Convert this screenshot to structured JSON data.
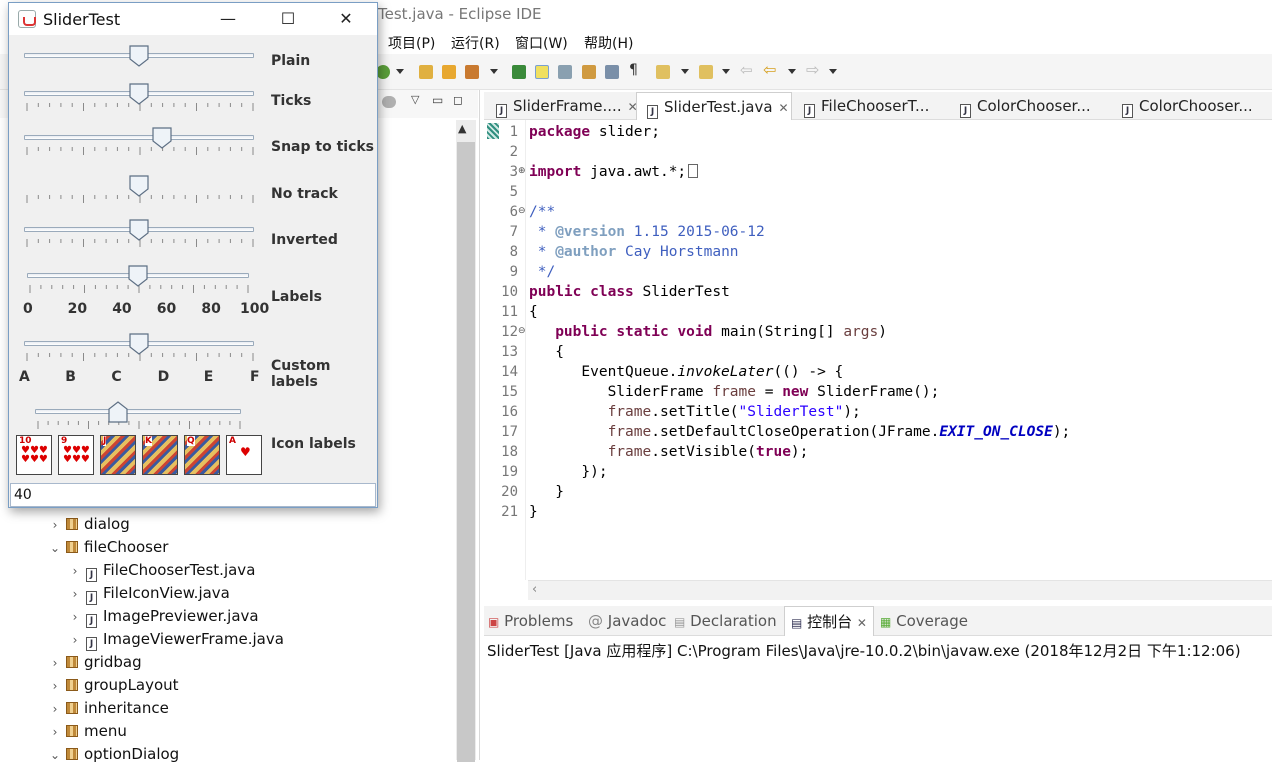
{
  "eclipse": {
    "title": "Test.java - Eclipse IDE",
    "menus": [
      "项目(P)",
      "运行(R)",
      "窗口(W)",
      "帮助(H)"
    ]
  },
  "tree": {
    "rows": [
      {
        "label": "dialog",
        "expanded": false,
        "type": "package"
      },
      {
        "label": "fileChooser",
        "expanded": true,
        "type": "package"
      },
      {
        "label": "FileChooserTest.java",
        "type": "java"
      },
      {
        "label": "FileIconView.java",
        "type": "java"
      },
      {
        "label": "ImagePreviewer.java",
        "type": "java"
      },
      {
        "label": "ImageViewerFrame.java",
        "type": "java"
      },
      {
        "label": "gridbag",
        "expanded": false,
        "type": "package"
      },
      {
        "label": "groupLayout",
        "expanded": false,
        "type": "package"
      },
      {
        "label": "inheritance",
        "expanded": false,
        "type": "package"
      },
      {
        "label": "menu",
        "expanded": false,
        "type": "package"
      },
      {
        "label": "optionDialog",
        "expanded": true,
        "type": "package"
      }
    ]
  },
  "editor": {
    "tabs": [
      "SliderFrame....",
      "SliderTest.java",
      "FileChooserT...",
      "ColorChooser...",
      "ColorChooser..."
    ],
    "active_tab": 1,
    "line_numbers": [
      "1",
      "2",
      "3",
      "5",
      "6",
      "7",
      "8",
      "9",
      "10",
      "11",
      "12",
      "13",
      "14",
      "15",
      "16",
      "17",
      "18",
      "19",
      "20",
      "21"
    ]
  },
  "console": {
    "tabs": [
      "Problems",
      "Javadoc",
      "Declaration",
      "控制台",
      "Coverage"
    ],
    "active_tab": 3,
    "line": "SliderTest [Java 应用程序] C:\\Program Files\\Java\\jre-10.0.2\\bin\\javaw.exe  (2018年12月2日 下午1:12:06)"
  },
  "swing": {
    "title": "SliderTest",
    "sliders": [
      {
        "label": "Plain",
        "value": 50
      },
      {
        "label": "Ticks",
        "value": 50
      },
      {
        "label": "Snap to ticks",
        "value": 60
      },
      {
        "label": "No track",
        "value": 50
      },
      {
        "label": "Inverted",
        "value": 50
      },
      {
        "label": "Labels",
        "value": 50
      },
      {
        "label": "Custom labels",
        "value": 50
      },
      {
        "label": "Icon labels",
        "value": 40
      }
    ],
    "number_labels": [
      "0",
      "20",
      "40",
      "60",
      "80",
      "100"
    ],
    "letter_labels": [
      "A",
      "B",
      "C",
      "D",
      "E",
      "F"
    ],
    "card_labels": [
      "10",
      "9",
      "J",
      "K",
      "Q",
      "A"
    ],
    "value_field": "40"
  }
}
